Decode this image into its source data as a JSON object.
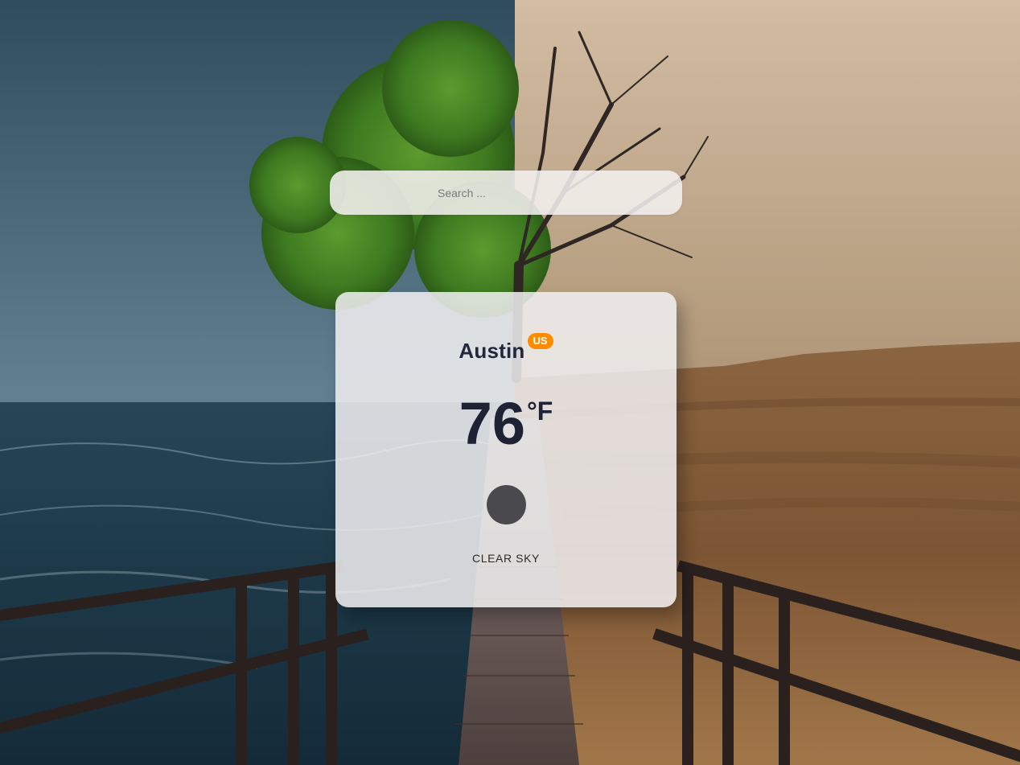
{
  "search": {
    "placeholder": "Search ..."
  },
  "weather": {
    "city": "Austin",
    "country": "US",
    "temperature": "76",
    "unit": "°F",
    "description": "CLEAR SKY"
  },
  "colors": {
    "badge": "#ff8c00",
    "text_dark": "#1e2234",
    "icon": "#4a4a4e"
  }
}
